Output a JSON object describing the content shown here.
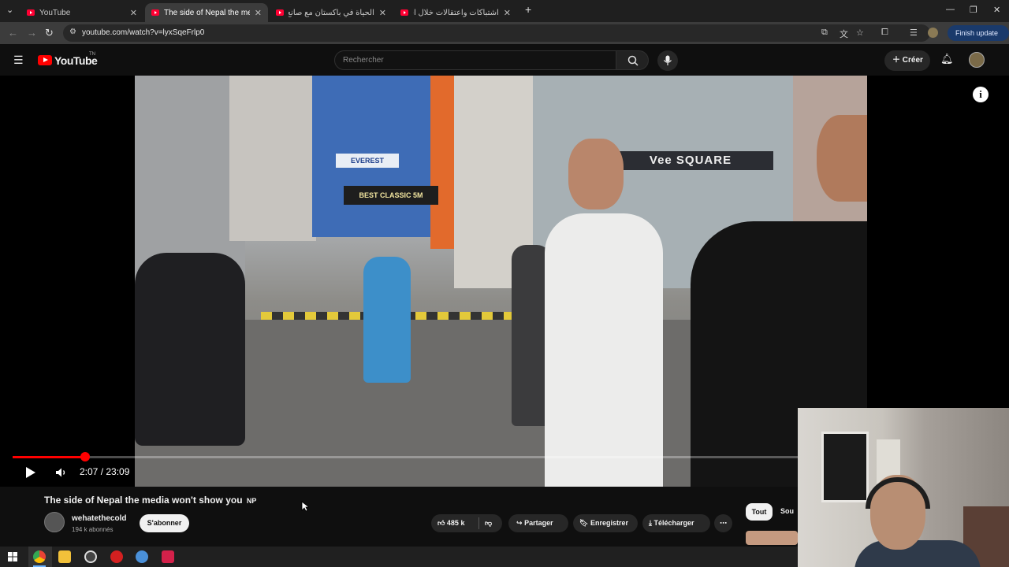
{
  "browser": {
    "tabs": [
      {
        "title": "YouTube",
        "active": false
      },
      {
        "title": "The side of Nepal the media won't",
        "active": true
      },
      {
        "title": "الحياة في باكستان مع صانع السلام",
        "active": false
      },
      {
        "title": "اشتباكات واعتقالات خلال احتجاجات",
        "active": false
      }
    ],
    "url": "youtube.com/watch?v=lyxSqeFrlp0",
    "finish_update": "Finish update"
  },
  "youtube": {
    "logo_text": "YouTube",
    "logo_tm": "TN",
    "search_placeholder": "Rechercher",
    "create_label": "Créer"
  },
  "player": {
    "current_time": "2:07",
    "duration": "23:09",
    "time_display": "2:07 / 23:09",
    "progress_fraction": 0.092
  },
  "video": {
    "title": "The side of Nepal the media won't show you",
    "country_badge": "NP",
    "channel_name": "wehatethecold",
    "subscribers": "194 k abonnés",
    "subscribe_label": "S'abonner",
    "likes": "485 k",
    "share_label": "Partager",
    "save_label": "Enregistrer",
    "download_label": "Télécharger"
  },
  "sidebar": {
    "chips": [
      "Tout",
      "Sou"
    ]
  },
  "scene_signs": {
    "sign1": "Vee SQUARE",
    "sign2": "EVEREST",
    "sign3": "BEST CLASSIC 5M"
  },
  "colors": {
    "accent": "#ff0000",
    "background": "#0f0f0f"
  }
}
